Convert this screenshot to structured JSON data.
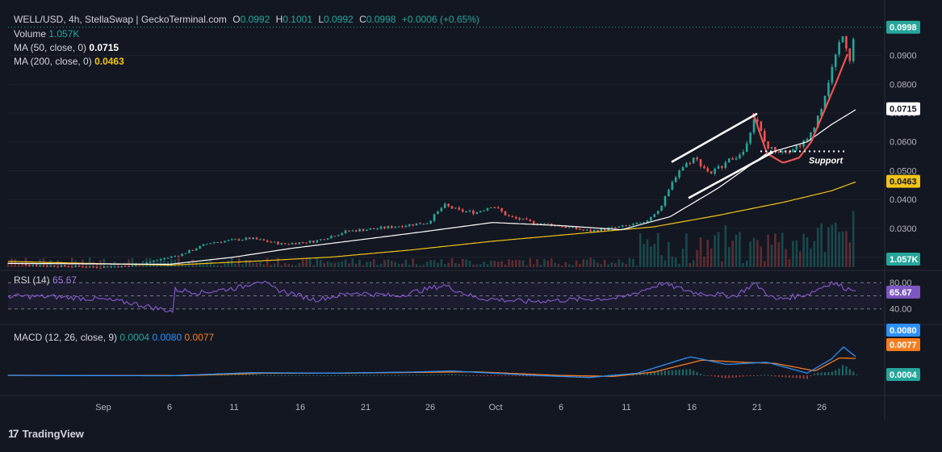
{
  "header": {
    "symbol": "WELL/USD, 4h, StellaSwap | GeckoTerminal.com",
    "open_label": "O",
    "open": "0.0992",
    "high_label": "H",
    "high": "0.1001",
    "low_label": "L",
    "low": "0.0992",
    "close_label": "C",
    "close": "0.0998",
    "change": "+0.0006 (+0.65%)",
    "volume_label": "Volume",
    "volume_value": "1.057K",
    "ma50_label": "MA (50, close, 0)",
    "ma50_value": "0.0715",
    "ma200_label": "MA (200, close, 0)",
    "ma200_value": "0.0463"
  },
  "rsi": {
    "label": "RSI (14)",
    "value": "65.67",
    "tick_high": "80.00",
    "tick_low": "40.00"
  },
  "macd": {
    "label": "MACD (12, 26, close, 9)",
    "hist": "0.0004",
    "macd": "0.0080",
    "signal": "0.0077"
  },
  "annotation": {
    "support": "Support"
  },
  "branding": {
    "name": "TradingView",
    "icon": "tradingview-logo-icon"
  },
  "colors": {
    "up": "#26a69a",
    "down": "#ef5350",
    "ma50": "#ffffff",
    "ma200": "#f0c419",
    "rsi": "#7e57c2",
    "macd": "#2e8ff5",
    "signal": "#f57c1f",
    "price_tag": "#26a69a"
  },
  "chart_data": {
    "type": "candlestick",
    "price_ticks": [
      "0.0200",
      "0.0300",
      "0.0400",
      "0.0500",
      "0.0600",
      "0.0700",
      "0.0800",
      "0.0900"
    ],
    "price_range": [
      0.0165,
      0.1042
    ],
    "x_ticks": [
      "Sep",
      "6",
      "11",
      "16",
      "21",
      "26",
      "Oct",
      "6",
      "11",
      "16",
      "21",
      "26"
    ],
    "last_price": "0.0998",
    "volume_tag": "1.057K",
    "ma50_tag": "0.0715",
    "ma200_tag": "0.0463",
    "close_keypoints": [
      [
        0,
        0.018
      ],
      [
        40,
        0.017
      ],
      [
        110,
        0.0165
      ],
      [
        150,
        0.0168
      ],
      [
        178,
        0.0185
      ],
      [
        215,
        0.021
      ],
      [
        250,
        0.025
      ],
      [
        300,
        0.0265
      ],
      [
        340,
        0.0245
      ],
      [
        380,
        0.0255
      ],
      [
        420,
        0.029
      ],
      [
        460,
        0.03
      ],
      [
        490,
        0.031
      ],
      [
        520,
        0.032
      ],
      [
        540,
        0.038
      ],
      [
        560,
        0.036
      ],
      [
        580,
        0.0355
      ],
      [
        600,
        0.038
      ],
      [
        620,
        0.034
      ],
      [
        650,
        0.032
      ],
      [
        680,
        0.031
      ],
      [
        720,
        0.029
      ],
      [
        760,
        0.0305
      ],
      [
        790,
        0.032
      ],
      [
        810,
        0.038
      ],
      [
        830,
        0.05
      ],
      [
        850,
        0.0545
      ],
      [
        870,
        0.049
      ],
      [
        890,
        0.053
      ],
      [
        910,
        0.056
      ],
      [
        925,
        0.069
      ],
      [
        940,
        0.058
      ],
      [
        955,
        0.057
      ],
      [
        970,
        0.0575
      ],
      [
        990,
        0.0605
      ],
      [
        1005,
        0.07
      ],
      [
        1020,
        0.085
      ],
      [
        1035,
        0.099
      ],
      [
        1042,
        0.088
      ],
      [
        1050,
        0.0998
      ]
    ],
    "ma50_keypoints": [
      [
        0,
        0.0178
      ],
      [
        200,
        0.0175
      ],
      [
        280,
        0.02
      ],
      [
        350,
        0.023
      ],
      [
        450,
        0.0265
      ],
      [
        520,
        0.029
      ],
      [
        600,
        0.032
      ],
      [
        680,
        0.031
      ],
      [
        760,
        0.0295
      ],
      [
        820,
        0.034
      ],
      [
        880,
        0.044
      ],
      [
        940,
        0.056
      ],
      [
        990,
        0.06
      ],
      [
        1020,
        0.066
      ],
      [
        1052,
        0.0715
      ]
    ],
    "ma200_keypoints": [
      [
        0,
        0.0185
      ],
      [
        100,
        0.0178
      ],
      [
        200,
        0.0172
      ],
      [
        300,
        0.0185
      ],
      [
        400,
        0.02
      ],
      [
        500,
        0.0225
      ],
      [
        600,
        0.0255
      ],
      [
        700,
        0.028
      ],
      [
        800,
        0.0305
      ],
      [
        880,
        0.0345
      ],
      [
        960,
        0.039
      ],
      [
        1020,
        0.043
      ],
      [
        1052,
        0.0463
      ]
    ],
    "red_curve_keypoints": [
      [
        923,
        0.07
      ],
      [
        940,
        0.056
      ],
      [
        960,
        0.0527
      ],
      [
        980,
        0.0545
      ],
      [
        995,
        0.06
      ],
      [
        1010,
        0.07
      ],
      [
        1025,
        0.08
      ],
      [
        1040,
        0.0905
      ]
    ],
    "channel_upper": [
      [
        822,
        0.053
      ],
      [
        928,
        0.0698
      ]
    ],
    "channel_lower": [
      [
        843,
        0.0405
      ],
      [
        948,
        0.0565
      ]
    ],
    "support_line": [
      [
        932,
        0.0567
      ],
      [
        1040,
        0.0567
      ]
    ],
    "rsi_range": [
      20,
      95
    ],
    "rsi_bands": [
      80,
      60,
      40
    ],
    "rsi_keypoints": [
      [
        0,
        0.5
      ],
      [
        60,
        0.48
      ],
      [
        110,
        0.42
      ],
      [
        150,
        0.32
      ],
      [
        180,
        0.18
      ],
      [
        204,
        0.08
      ],
      [
        206,
        0.68
      ],
      [
        240,
        0.6
      ],
      [
        290,
        0.75
      ],
      [
        310,
        0.95
      ],
      [
        330,
        0.7
      ],
      [
        380,
        0.4
      ],
      [
        430,
        0.6
      ],
      [
        480,
        0.5
      ],
      [
        540,
        0.8
      ],
      [
        580,
        0.45
      ],
      [
        640,
        0.35
      ],
      [
        700,
        0.4
      ],
      [
        760,
        0.45
      ],
      [
        810,
        0.85
      ],
      [
        850,
        0.6
      ],
      [
        900,
        0.5
      ],
      [
        925,
        0.85
      ],
      [
        950,
        0.4
      ],
      [
        990,
        0.55
      ],
      [
        1020,
        0.88
      ],
      [
        1040,
        0.7
      ],
      [
        1052,
        0.72
      ]
    ],
    "macd_keypoints": [
      [
        0,
        0.0
      ],
      [
        200,
        -0.0002
      ],
      [
        300,
        0.0012
      ],
      [
        400,
        0.001
      ],
      [
        500,
        0.0015
      ],
      [
        550,
        0.002
      ],
      [
        650,
        0.0
      ],
      [
        720,
        -0.001
      ],
      [
        780,
        0.001
      ],
      [
        845,
        0.0085
      ],
      [
        890,
        0.005
      ],
      [
        940,
        0.006
      ],
      [
        990,
        0.001
      ],
      [
        1020,
        0.0075
      ],
      [
        1035,
        0.013
      ],
      [
        1052,
        0.008
      ]
    ],
    "signal_keypoints": [
      [
        0,
        0.0
      ],
      [
        220,
        -0.0001
      ],
      [
        320,
        0.001
      ],
      [
        420,
        0.001
      ],
      [
        520,
        0.0014
      ],
      [
        580,
        0.0016
      ],
      [
        680,
        0.0
      ],
      [
        750,
        -0.0005
      ],
      [
        800,
        0.0015
      ],
      [
        860,
        0.007
      ],
      [
        910,
        0.006
      ],
      [
        950,
        0.0055
      ],
      [
        1000,
        0.002
      ],
      [
        1030,
        0.008
      ],
      [
        1052,
        0.0077
      ]
    ]
  }
}
